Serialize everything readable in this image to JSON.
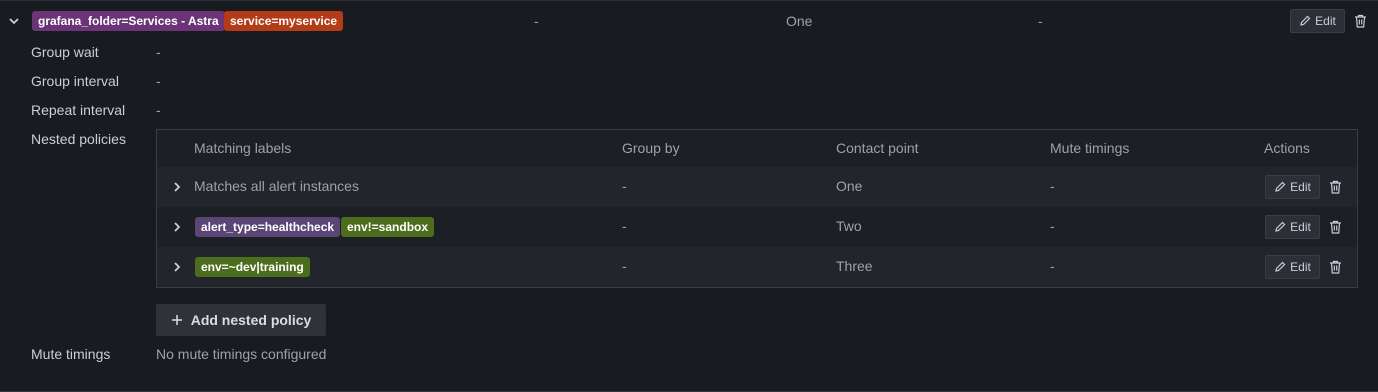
{
  "policy": {
    "labels": [
      {
        "text": "grafana_folder=Services - Astra",
        "color": "#6a3476"
      },
      {
        "text": "service=myservice",
        "color": "#b43b18"
      }
    ],
    "group_by": "-",
    "contact_point": "One",
    "mute_timings": "-",
    "edit_label": "Edit"
  },
  "details": {
    "group_wait_label": "Group wait",
    "group_wait_value": "-",
    "group_interval_label": "Group interval",
    "group_interval_value": "-",
    "repeat_interval_label": "Repeat interval",
    "repeat_interval_value": "-",
    "nested_policies_label": "Nested policies",
    "mute_timings_label": "Mute timings",
    "mute_timings_value": "No mute timings configured"
  },
  "nested": {
    "headers": {
      "matching_labels": "Matching labels",
      "group_by": "Group by",
      "contact_point": "Contact point",
      "mute_timings": "Mute timings",
      "actions": "Actions"
    },
    "rows": [
      {
        "match_text": "Matches all alert instances",
        "group_by": "-",
        "contact_point": "One",
        "mute_timings": "-",
        "edit_label": "Edit"
      },
      {
        "tags": [
          {
            "text": "alert_type=healthcheck",
            "color": "#5a4577"
          },
          {
            "text": "env!=sandbox",
            "color": "#4d6d1e"
          }
        ],
        "group_by": "-",
        "contact_point": "Two",
        "mute_timings": "-",
        "edit_label": "Edit"
      },
      {
        "tags": [
          {
            "text": "env=~dev|training",
            "color": "#4d6d1e"
          }
        ],
        "group_by": "-",
        "contact_point": "Three",
        "mute_timings": "-",
        "edit_label": "Edit"
      }
    ]
  },
  "add_nested_policy_label": "Add nested policy",
  "icons": {
    "expand": "chevron-down-icon",
    "row_expand": "chevron-right-icon",
    "edit": "pencil-icon",
    "delete": "trash-icon",
    "add": "plus-icon"
  }
}
